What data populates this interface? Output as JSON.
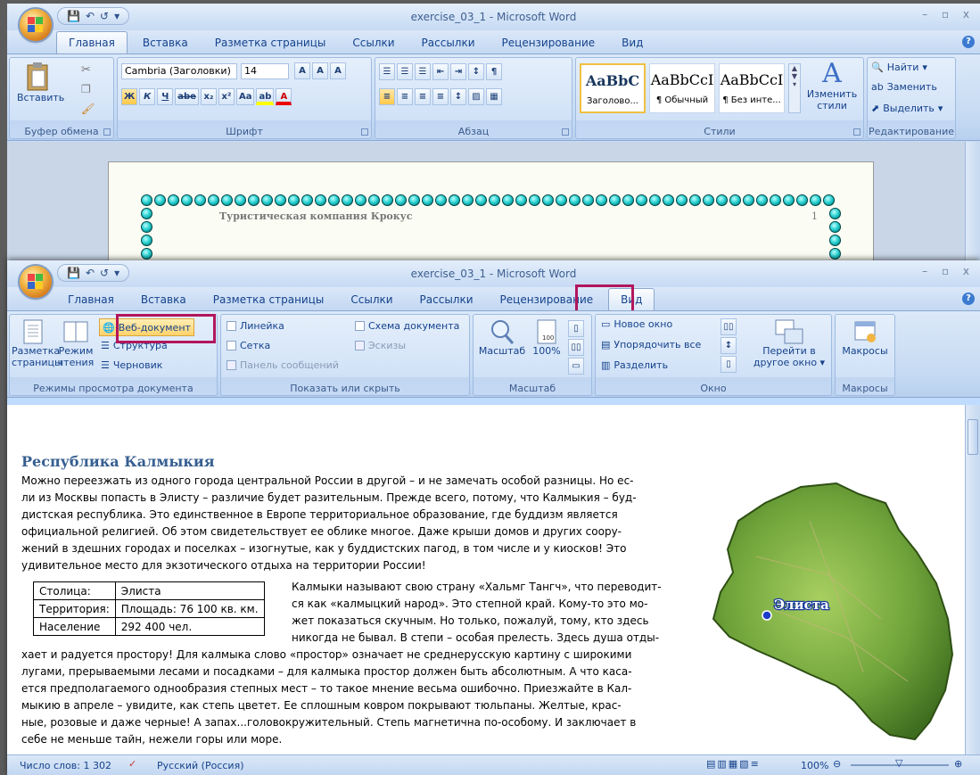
{
  "window": {
    "title": "exercise_03_1 - Microsoft Word"
  },
  "tabs": [
    "Главная",
    "Вставка",
    "Разметка страницы",
    "Ссылки",
    "Рассылки",
    "Рецензирование",
    "Вид"
  ],
  "home": {
    "clipboard": {
      "paste": "Вставить",
      "label": "Буфер обмена"
    },
    "font": {
      "name": "Cambria (Заголовки)",
      "size": "14",
      "label": "Шрифт",
      "bold": "Ж",
      "italic": "К",
      "underline": "Ч",
      "strike": "abe",
      "sub": "x₂",
      "sup": "x²",
      "case": "Aa",
      "grow": "A",
      "shrink": "A",
      "clear": "A"
    },
    "paragraph": {
      "label": "Абзац"
    },
    "styles": {
      "label": "Стили",
      "items": [
        {
          "preview": "AaBbC",
          "name": "Заголово..."
        },
        {
          "preview": "AaBbCcI",
          "name": "¶ Обычный"
        },
        {
          "preview": "AaBbCcI",
          "name": "¶ Без инте..."
        }
      ],
      "change": "Изменить стили"
    },
    "editing": {
      "find": "Найти",
      "replace": "Заменить",
      "select": "Выделить",
      "label": "Редактирование"
    }
  },
  "document_top": {
    "header": "Туристическая компания Крокус",
    "page_number": "1"
  },
  "view": {
    "doc_views": {
      "print": "Разметка страницы",
      "reading": "Режим чтения",
      "web": "Веб-документ",
      "outline": "Структура",
      "draft": "Черновик",
      "label": "Режимы просмотра документа"
    },
    "show_hide": {
      "ruler": "Линейка",
      "grid": "Сетка",
      "messages": "Панель сообщений",
      "docmap": "Схема документа",
      "thumbs": "Эскизы",
      "label": "Показать или скрыть"
    },
    "zoom": {
      "zoom": "Масштаб",
      "percent": "100%",
      "label": "Масштаб"
    },
    "window_grp": {
      "new": "Новое окно",
      "arrange": "Упорядочить все",
      "split": "Разделить",
      "switch": "Перейти в другое окно",
      "label": "Окно"
    },
    "macros": {
      "button": "Макросы",
      "label": "Макросы"
    }
  },
  "doc": {
    "title": "Республика Калмыкия",
    "paragraph1": [
      "Можно переезжать из одного города центральной России в другой – и не замечать особой разницы. Но ес-",
      "ли из Москвы попасть в Элисту – различие будет разительным. Прежде всего, потому, что Калмыкия – буд-",
      "дистская республика. Это единственное в Европе территориальное образование, где буддизм является",
      "официальной религией. Об этом свидетельствует ее облике многое. Даже крыши домов и других соору-",
      "жений в здешних городах и поселках – изогнутые, как у буддистских пагод, в том числе и у киосков! Это",
      "удивительное место для экзотического отдыха на территории России!"
    ],
    "table": [
      [
        "Столица:",
        "Элиста"
      ],
      [
        "Территория:",
        "Площадь: 76 100 кв. км."
      ],
      [
        "Население",
        "292 400 чел."
      ]
    ],
    "paragraph2_side": [
      "Калмыки называют свою страну «Хальмг Тангч», что переводит-",
      "ся как «калмыцкий народ». Это степной край. Кому-то это мо-",
      "жет показаться скучным. Но только, пожалуй, тому, кто здесь",
      "никогда не бывал. В степи – особая прелесть. Здесь душа отды-"
    ],
    "paragraph2_full": [
      "хает и радуется простору! Для калмыка слово «простор» означает не среднерусскую картину с широкими",
      "лугами, прерываемыми лесами и посадками – для калмыка простор должен быть абсолютным. А что каса-",
      "ется предполагаемого однообразия степных мест – то такое мнение весьма ошибочно. Приезжайте в Кал-",
      "мыкию в апреле – увидите, как степь цветет. Ее сплошным ковром покрывают тюльпаны. Желтые, крас-",
      "ные, розовые и даже черные! А запах...головокружительный. Степь магнетична по-особому. И заключает в",
      "себе не меньше тайн, нежели горы или море."
    ],
    "map_label": "Элиста"
  },
  "status": {
    "words": "Число слов: 1 302",
    "language": "Русский (Россия)",
    "zoom": "100%"
  },
  "colors": {
    "highlight": "#b2165c",
    "heading": "#365f91",
    "map_green": "#6fa33a"
  }
}
